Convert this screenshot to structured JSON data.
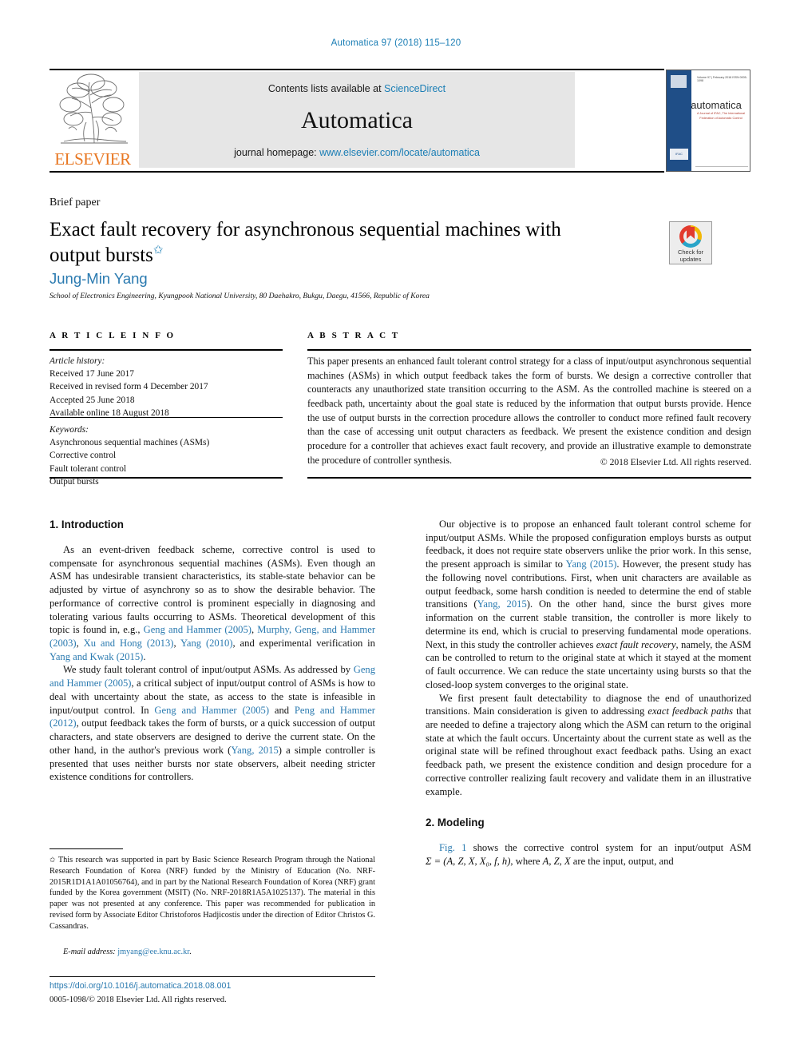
{
  "running_head": "Automatica 97 (2018) 115–120",
  "header": {
    "publisher_name": "ELSEVIER",
    "contents_prefix": "Contents lists available at ",
    "contents_link": "ScienceDirect",
    "journal_title": "Automatica",
    "homepage_prefix": "journal homepage: ",
    "homepage_link": "www.elsevier.com/locate/automatica",
    "cover": {
      "journal_name": "automatica",
      "top_line": "Volume 97 | February 2018    ISSN 0005-1098",
      "tagline": "A Journal of IFAC, The International Federation of Automatic Control",
      "ifac_label": "IFAC"
    }
  },
  "article": {
    "type": "Brief paper",
    "title": "Exact fault recovery for asynchronous sequential machines with output bursts",
    "title_marker": "✩",
    "author": "Jung-Min Yang",
    "affiliation": "School of Electronics Engineering, Kyungpook National University, 80 Daehakro, Bukgu, Daegu, 41566, Republic of Korea",
    "crossmark_label": "Check for updates"
  },
  "info": {
    "heading": "A R T I C L E   I N F O",
    "history_label": "Article history:",
    "history": [
      "Received 17 June 2017",
      "Received in revised form 4 December 2017",
      "Accepted 25 June 2018",
      "Available online 18 August 2018"
    ],
    "keywords_label": "Keywords:",
    "keywords": [
      "Asynchronous sequential machines (ASMs)",
      "Corrective control",
      "Fault tolerant control",
      "Output bursts"
    ]
  },
  "abstract": {
    "heading": "A B S T R A C T",
    "text": "This paper presents an enhanced fault tolerant control strategy for a class of input/output asynchronous sequential machines (ASMs) in which output feedback takes the form of bursts. We design a corrective controller that counteracts any unauthorized state transition occurring to the ASM. As the controlled machine is steered on a feedback path, uncertainty about the goal state is reduced by the information that output bursts provide. Hence the use of output bursts in the correction procedure allows the controller to conduct more refined fault recovery than the case of accessing unit output characters as feedback. We present the existence condition and design procedure for a controller that achieves exact fault recovery, and provide an illustrative example to demonstrate the procedure of controller synthesis.",
    "copyright": "© 2018 Elsevier Ltd. All rights reserved."
  },
  "body": {
    "section1_heading": "1. Introduction",
    "section2_heading": "2. Modeling",
    "p1_a": "As an event-driven feedback scheme, corrective control is used to compensate for asynchronous sequential machines (ASMs). Even though an ASM has undesirable transient characteristics, its stable-state behavior can be adjusted by virtue of asynchrony so as to show the desirable behavior. The performance of corrective control is prominent especially in diagnosing and tolerating various faults occurring to ASMs. Theoretical development of this topic is found in, e.g., ",
    "p1_c1": "Geng and Hammer",
    "p1_c1y": "(2005)",
    "p1_b": ", ",
    "p1_c2": "Murphy, Geng, and Hammer",
    "p1_c2y": "(2003)",
    "p1_c3": "Xu and Hong",
    "p1_c3y": "(2013)",
    "p1_c4": "Yang",
    "p1_c4y": "(2010)",
    "p1_d": ", and experimental verification in ",
    "p1_c5": "Yang and Kwak",
    "p1_c5y": "(2015)",
    "p1_e": ".",
    "p2_a": "We study fault tolerant control of input/output ASMs. As addressed by ",
    "p2_c1": "Geng and Hammer",
    "p2_c1y": "(2005)",
    "p2_b": ", a critical subject of input/output control of ASMs is how to deal with uncertainty about the state, as access to the state is infeasible in input/output control. In ",
    "p2_c2": "Geng and Hammer",
    "p2_c2y": "(2005)",
    "p2_c": " and ",
    "p2_c3": "Peng and Hammer",
    "p2_c3y": "(2012)",
    "p2_d": ", output feedback takes the form of bursts, or a quick succession of output characters, and state observers are designed to derive the current state. On the other hand, in the author's previous work (",
    "p2_c4": "Yang, 2015",
    "p2_e": ") a simple controller is presented that uses neither bursts nor state observers, albeit needing stricter existence conditions for controllers.",
    "r1_a": "Our objective is to propose an enhanced fault tolerant control scheme for input/output ASMs. While the proposed configuration employs bursts as output feedback, it does not require state observers unlike the prior work. In this sense, the present approach is similar to ",
    "r1_c1": "Yang",
    "r1_c1y": "(2015)",
    "r1_b": ". However, the present study has the following novel contributions. First, when unit characters are available as output feedback, some harsh condition is needed to determine the end of stable transitions (",
    "r1_c2": "Yang, 2015",
    "r1_c": "). On the other hand, since the burst gives more information on the current stable transition, the controller is more likely to determine its end, which is crucial to preserving fundamental mode operations. Next, in this study the controller achieves ",
    "r1_em1": "exact fault recovery",
    "r1_d": ", namely, the ASM can be controlled to return to the original state at which it stayed at the moment of fault occurrence. We can reduce the state uncertainty using bursts so that the closed-loop system converges to the original state.",
    "r2_a": "We first present fault detectability to diagnose the end of unauthorized transitions. Main consideration is given to addressing ",
    "r2_em1": "exact feedback paths",
    "r2_b": " that are needed to define a trajectory along which the ASM can return to the original state at which the fault occurs. Uncertainty about the current state as well as the original state will be refined throughout exact feedback paths. Using an exact feedback path, we present the existence condition and design procedure for a corrective controller realizing fault recovery and validate them in an illustrative example.",
    "r3_fig": "Fig. 1",
    "r3_a": " shows the corrective control system for an input/output ASM ",
    "r3_math": "Σ = (A, Z, X, X₀, f, h)",
    "r3_b": ", where ",
    "r3_math2": "A, Z, X",
    "r3_c": " are the input, output, and"
  },
  "footnote": {
    "marker": "✩",
    "text": "This research was supported in part by Basic Science Research Program through the National Research Foundation of Korea (NRF) funded by the Ministry of Education (No. NRF-2015R1D1A1A01056764), and in part by the National Research Foundation of Korea (NRF) grant funded by the Korea government (MSIT) (No. NRF-2018R1A5A1025137). The material in this paper was not presented at any conference. This paper was recommended for publication in revised form by Associate Editor Christoforos Hadjicostis under the direction of Editor Christos G. Cassandras.",
    "email_label": "E-mail address:",
    "email": "jmyang@ee.knu.ac.kr",
    "email_trail": ".",
    "doi": "https://doi.org/10.1016/j.automatica.2018.08.001",
    "issn": "0005-1098/© 2018 Elsevier Ltd. All rights reserved."
  }
}
